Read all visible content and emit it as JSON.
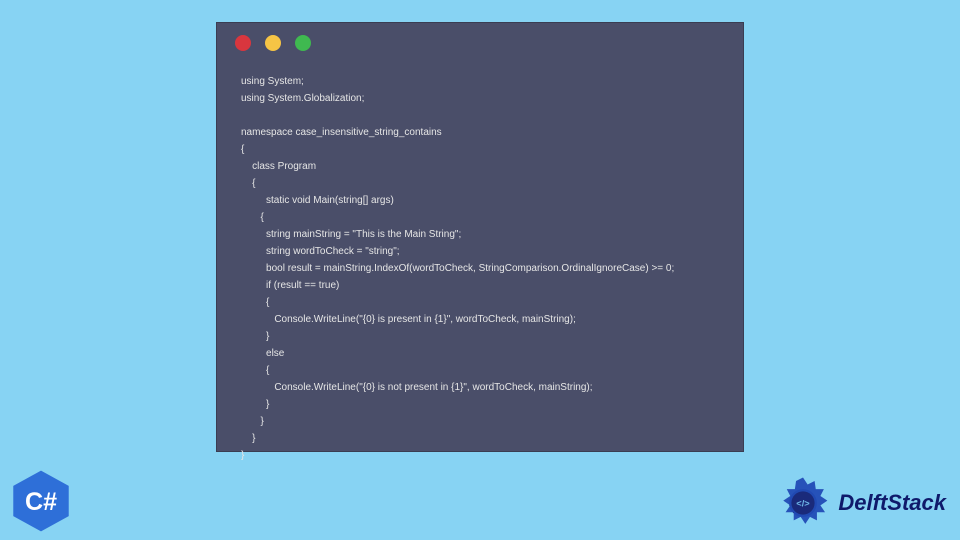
{
  "window": {
    "dots": {
      "red": "#d9363e",
      "yellow": "#f6c445",
      "green": "#3fb950"
    }
  },
  "code": {
    "lines": [
      "using System;",
      "using System.Globalization;",
      "",
      "namespace case_insensitive_string_contains",
      "{",
      "    class Program",
      "    {",
      "         static void Main(string[] args)",
      "       {",
      "         string mainString = \"This is the Main String\";",
      "         string wordToCheck = \"string\";",
      "         bool result = mainString.IndexOf(wordToCheck, StringComparison.OrdinalIgnoreCase) >= 0;",
      "         if (result == true)",
      "         {",
      "            Console.WriteLine(\"{0} is present in {1}\", wordToCheck, mainString);",
      "         }",
      "         else",
      "         {",
      "            Console.WriteLine(\"{0} is not present in {1}\", wordToCheck, mainString);",
      "         }",
      "       }",
      "    }",
      "}"
    ]
  },
  "badges": {
    "csharp_label": "C#",
    "brand_name": "DelftStack"
  },
  "colors": {
    "page_bg": "#87d3f3",
    "code_bg": "#4a4e69",
    "code_fg": "#e6e6e6",
    "csharp_blue": "#2e6fd8",
    "brand_navy": "#0f1a6b"
  }
}
